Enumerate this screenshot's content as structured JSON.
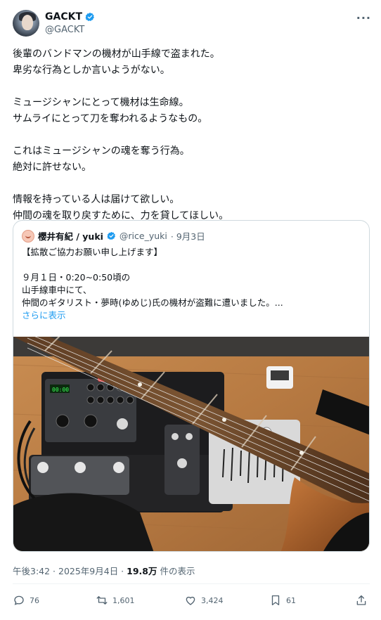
{
  "author": {
    "name": "GACKT",
    "handle": "@GACKT"
  },
  "tweet": {
    "paragraphs": [
      [
        "後輩のバンドマンの機材が山手線で盗まれた。",
        "卑劣な行為としか言いようがない。"
      ],
      [
        "ミュージシャンにとって機材は生命線。",
        "サムライにとって刀を奪われるようなもの。"
      ],
      [
        "これはミュージシャンの魂を奪う行為。",
        "絶対に許せない。"
      ],
      [
        "情報を持っている人は届けて欲しい。",
        "仲間の魂を取り戻すために、力を貸してほしい。"
      ]
    ]
  },
  "quote": {
    "name": "櫻井有紀 / yuki",
    "handle": "@rice_yuki",
    "date": "· 9月3日",
    "line1": "【拡散ご協力お願い申し上げます】",
    "line2": "９月１日・0:20~0:50頃の",
    "line3": "山手線車中にて、",
    "line4": "仲間のギタリスト・夢時(ゆめじ)氏の機材が盗難に遭いました。...",
    "show_more": "さらに表示"
  },
  "meta": {
    "time": "午後3:42 · 2025年9月4日 · ",
    "views": "19.8万",
    "views_label": " 件の表示"
  },
  "actions": {
    "replies": "76",
    "reposts": "1,601",
    "likes": "3,424",
    "bookmarks": "61"
  },
  "icons": [
    "verified-badge-icon",
    "more-icon",
    "reply-icon",
    "repost-icon",
    "like-icon",
    "bookmark-icon",
    "share-icon"
  ],
  "colors": {
    "accent": "#1d9bf0",
    "text": "#0f1419",
    "muted": "#536471",
    "border": "#cfd9de"
  }
}
